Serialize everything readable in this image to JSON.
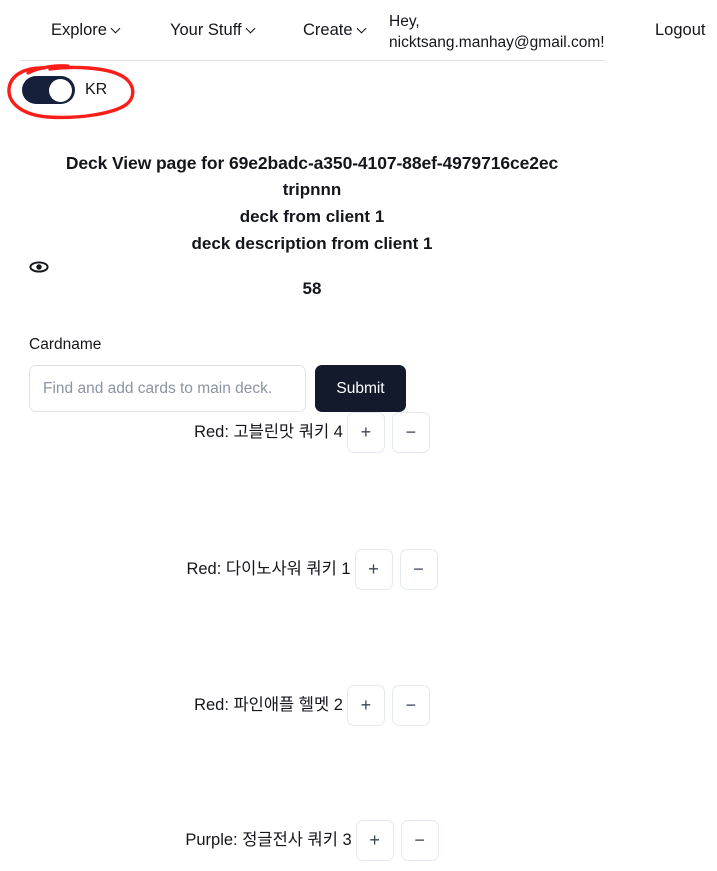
{
  "navbar": {
    "items": [
      {
        "label": "Explore",
        "icon": "chevron-down-icon"
      },
      {
        "label": "Your Stuff",
        "icon": "chevron-down-icon"
      },
      {
        "label": "Create",
        "icon": "chevron-down-icon"
      }
    ],
    "greeting_line1": "Hey,",
    "greeting_line2": "nicktsang.manhay@gmail.com!",
    "logout_label": "Logout"
  },
  "language_toggle": {
    "state": "on",
    "label": "KR",
    "annotation_color": "#fb1d18",
    "toggle_color": "#16203a",
    "knob_color": "#ffffff"
  },
  "deck": {
    "title": "Deck View page for 69e2badc-a350-4107-88ef-4979716ce2ec",
    "name": "tripnnn",
    "owner_line": "deck from client 1",
    "description": "deck description from client 1",
    "visibility_icon": "eye-icon",
    "count": "58"
  },
  "form": {
    "label": "Cardname",
    "placeholder": "Find and add cards to main deck.",
    "value": "",
    "submit_label": "Submit"
  },
  "cards": [
    {
      "label": "Red: 고블린맛 쿼키 4",
      "color": "Red",
      "name": "고블린맛 쿼키",
      "quantity": "4",
      "increment_label": "+",
      "decrement_label": "−"
    },
    {
      "label": "Red: 다이노사워 쿼키 1",
      "color": "Red",
      "name": "다이노사워 쿼키",
      "quantity": "1",
      "increment_label": "+",
      "decrement_label": "−"
    },
    {
      "label": "Red: 파인애플 헬멧 2",
      "color": "Red",
      "name": "파인애플 헬멧",
      "quantity": "2",
      "increment_label": "+",
      "decrement_label": "−"
    },
    {
      "label": "Purple: 정글전사 쿼키 3",
      "color": "Purple",
      "name": "정글전사 쿼키",
      "quantity": "3",
      "increment_label": "+",
      "decrement_label": "−"
    }
  ]
}
